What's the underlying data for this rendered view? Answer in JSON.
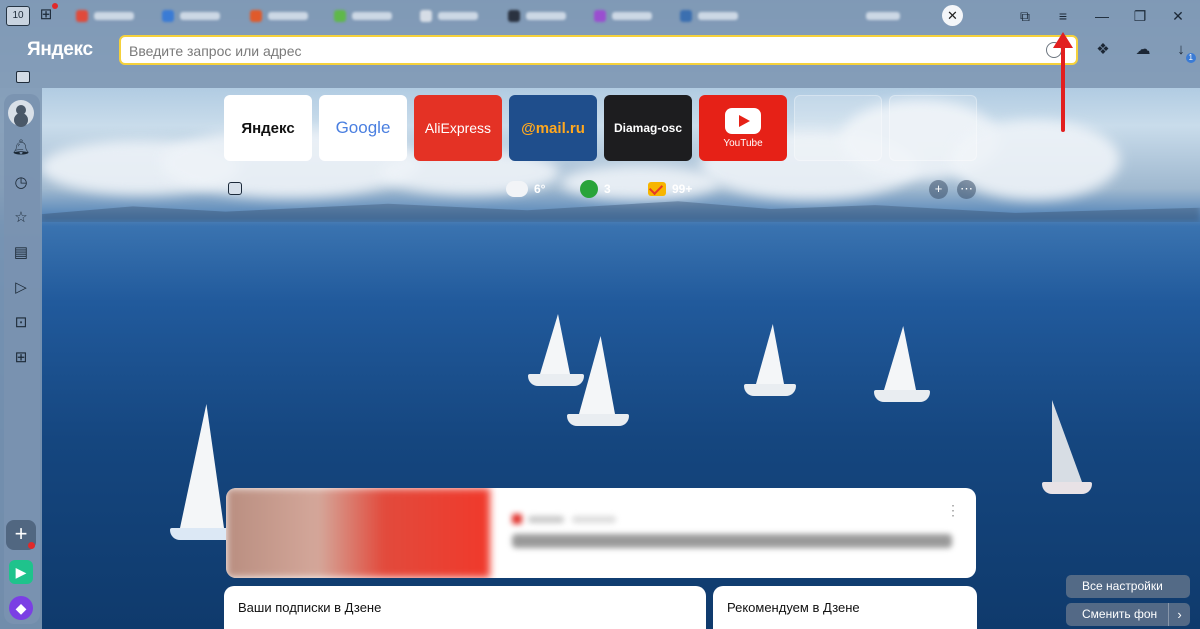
{
  "browser": {
    "tab_counter": "10",
    "logo": "Яндекс",
    "address_placeholder": "Введите запрос или адрес",
    "tab_close_icon": "close-icon",
    "window_controls": [
      "collections-icon",
      "menu-icon",
      "minimize-icon",
      "restore-icon",
      "close-icon"
    ],
    "download_badge": "1"
  },
  "tiles": [
    {
      "label": "Яндекс",
      "bg": "#ffffff"
    },
    {
      "label": "Google",
      "bg": "#ffffff"
    },
    {
      "label": "AliExpress",
      "bg": "#e43225"
    },
    {
      "label": "@mail.ru",
      "bg": "#1f4e8c"
    },
    {
      "label": "Diamag-osc",
      "bg": "#1d1d1f"
    },
    {
      "label": "YouTube",
      "bg": "#e62117"
    }
  ],
  "widgets": {
    "weather": "6°",
    "traffic": "3",
    "mail": "99+"
  },
  "zen": {
    "subscriptions": "Ваши подписки в Дзене",
    "recommended": "Рекомендуем в Дзене"
  },
  "buttons": {
    "all_settings": "Все настройки",
    "change_bg": "Сменить фон"
  },
  "colors": {
    "accent_yellow": "#f5d13b",
    "arrow_red": "#e21f1f"
  }
}
